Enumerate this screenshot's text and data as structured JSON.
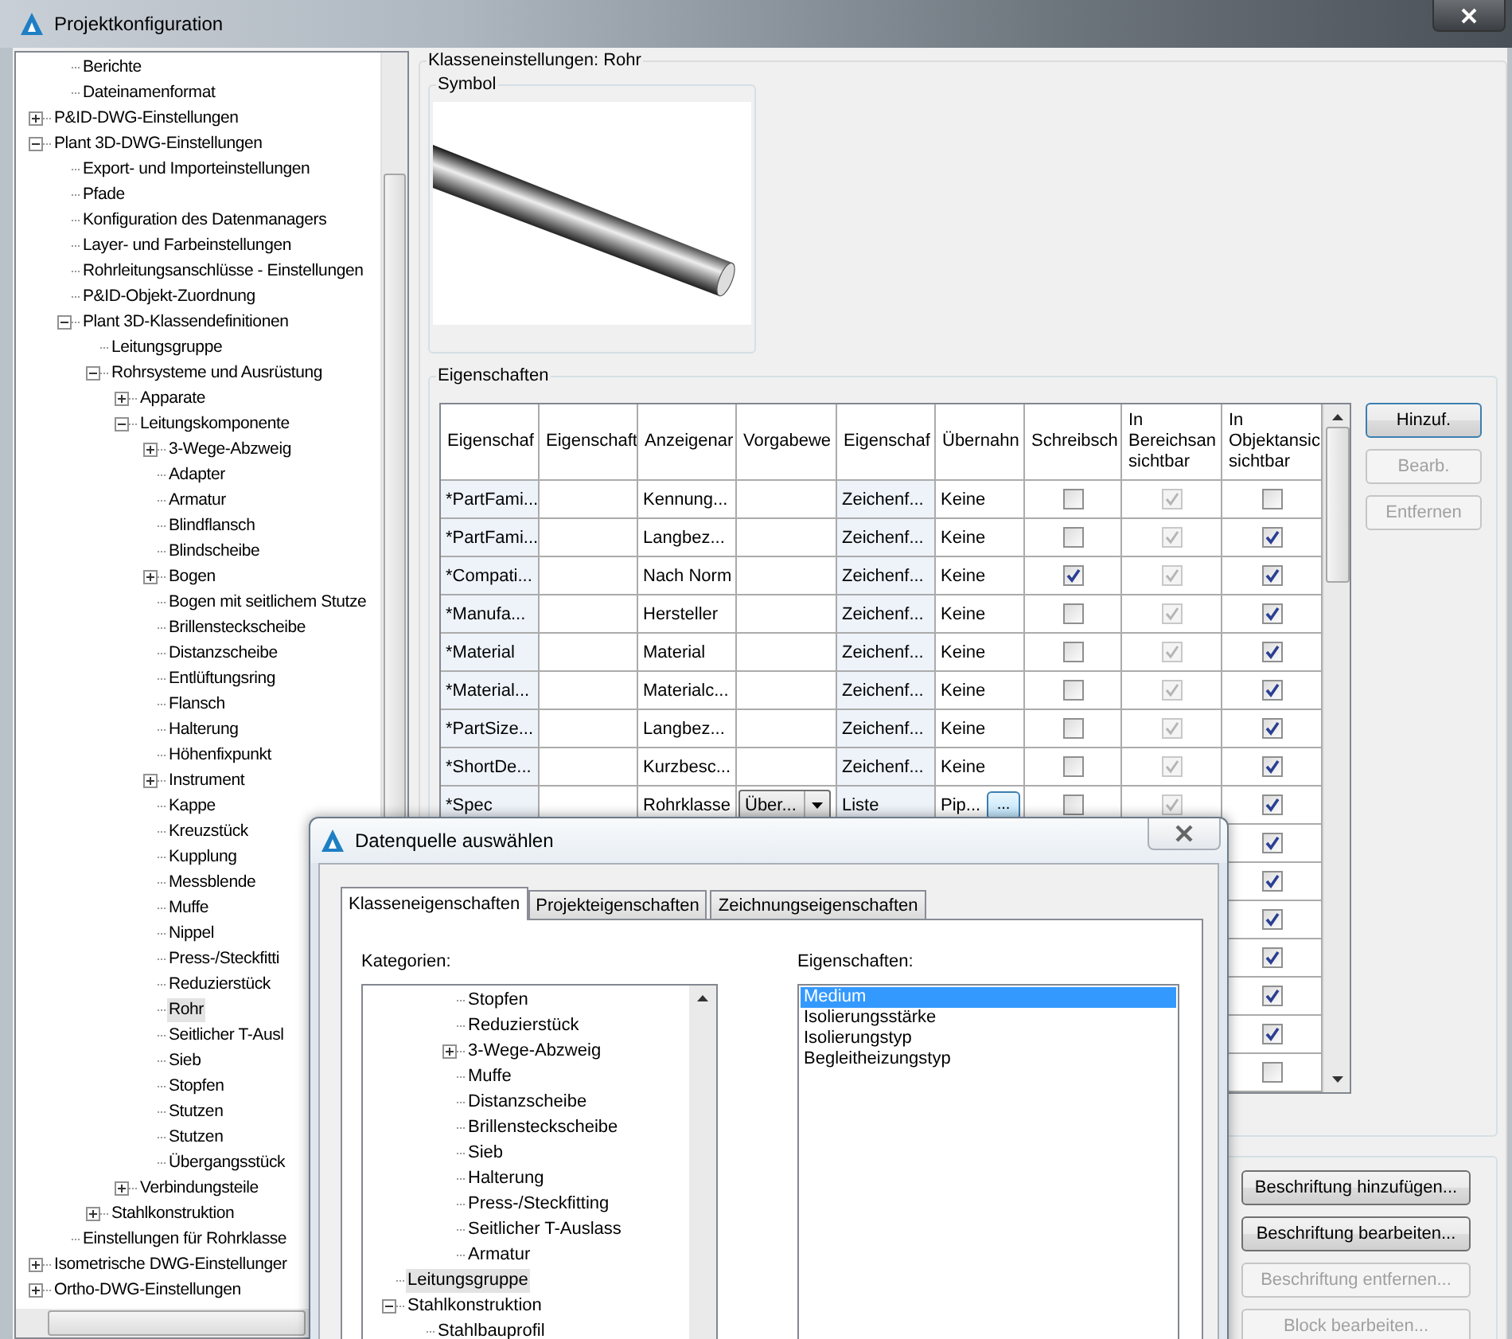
{
  "window": {
    "title": "Projektkonfiguration"
  },
  "tree": [
    {
      "children": [
        {
          "label": "Berichte",
          "selected": false
        },
        {
          "label": "Dateinamenformat",
          "selected": false
        }
      ]
    },
    {
      "label": "P&ID-DWG-Einstellungen",
      "selected": false,
      "expanded": false
    },
    {
      "label": "Plant 3D-DWG-Einstellungen",
      "selected": false,
      "expanded": true,
      "children": [
        {
          "label": "Export- und Importeinstellungen",
          "selected": false
        },
        {
          "label": "Pfade",
          "selected": false
        },
        {
          "label": "Konfiguration des Datenmanagers",
          "selected": false
        },
        {
          "label": "Layer- und Farbeinstellungen",
          "selected": false
        },
        {
          "label": "Rohrleitungsanschlüsse - Einstellungen",
          "selected": false
        },
        {
          "label": "P&ID-Objekt-Zuordnung",
          "selected": false
        },
        {
          "label": "Plant 3D-Klassendefinitionen",
          "selected": false,
          "expanded": true,
          "children": [
            {
              "label": "Leitungsgruppe",
              "selected": false
            },
            {
              "label": "Rohrsysteme und Ausrüstung",
              "selected": false,
              "expanded": true,
              "children": [
                {
                  "label": "Apparate",
                  "selected": false,
                  "expanded": false
                },
                {
                  "label": "Leitungskomponente",
                  "selected": false,
                  "expanded": true,
                  "children": [
                    {
                      "label": "3-Wege-Abzweig",
                      "selected": false,
                      "expanded": false
                    },
                    {
                      "label": "Adapter",
                      "selected": false
                    },
                    {
                      "label": "Armatur",
                      "selected": false
                    },
                    {
                      "label": "Blindflansch",
                      "selected": false
                    },
                    {
                      "label": "Blindscheibe",
                      "selected": false
                    },
                    {
                      "label": "Bogen",
                      "selected": false,
                      "expanded": false
                    },
                    {
                      "label": "Bogen mit seitlichem Stutze",
                      "selected": false
                    },
                    {
                      "label": "Brillensteckscheibe",
                      "selected": false
                    },
                    {
                      "label": "Distanzscheibe",
                      "selected": false
                    },
                    {
                      "label": "Entlüftungsring",
                      "selected": false
                    },
                    {
                      "label": "Flansch",
                      "selected": false
                    },
                    {
                      "label": "Halterung",
                      "selected": false
                    },
                    {
                      "label": "Höhenfixpunkt",
                      "selected": false
                    },
                    {
                      "label": "Instrument",
                      "selected": false,
                      "expanded": false
                    },
                    {
                      "label": "Kappe",
                      "selected": false
                    },
                    {
                      "label": "Kreuzstück",
                      "selected": false
                    },
                    {
                      "label": "Kupplung",
                      "selected": false
                    },
                    {
                      "label": "Messblende",
                      "selected": false
                    },
                    {
                      "label": "Muffe",
                      "selected": false
                    },
                    {
                      "label": "Nippel",
                      "selected": false
                    },
                    {
                      "label": "Press-/Steckfitti",
                      "selected": false
                    },
                    {
                      "label": "Reduzierstück",
                      "selected": false
                    },
                    {
                      "label": "Rohr",
                      "selected": true
                    },
                    {
                      "label": "Seitlicher T-Ausl",
                      "selected": false
                    },
                    {
                      "label": "Sieb",
                      "selected": false
                    },
                    {
                      "label": "Stopfen",
                      "selected": false
                    },
                    {
                      "label": "Stutzen",
                      "selected": false
                    },
                    {
                      "label": "Stutzen",
                      "selected": false
                    },
                    {
                      "label": "Übergangsstück",
                      "selected": false
                    }
                  ]
                },
                {
                  "label": "Verbindungsteile",
                  "selected": false,
                  "expanded": false
                }
              ]
            },
            {
              "label": "Stahlkonstruktion",
              "selected": false,
              "expanded": false
            }
          ]
        },
        {
          "label": "Einstellungen für Rohrklasse",
          "selected": false
        }
      ]
    },
    {
      "label": "Isometrische DWG-Einstellunger",
      "selected": false,
      "expanded": false
    },
    {
      "label": "Ortho-DWG-Einstellungen",
      "selected": false,
      "expanded": false
    }
  ],
  "class_settings": {
    "title": "Klasseneinstellungen: Rohr",
    "symbol_label": "Symbol"
  },
  "properties": {
    "title": "Eigenschaften",
    "columns": [
      "Eigenschaf",
      "Eigenschaft",
      "Anzeigenar",
      "Vorgabewe",
      "Eigenschaf",
      "Übernahn",
      "Schreibsch",
      "In\nBereichsan\nsichtbar",
      "In\nObjektansic\nsichtbar"
    ],
    "rows": [
      {
        "property": "*PartFami...",
        "display_name": "Kennung...",
        "type": "Zeichenf...",
        "transfer": "Keine",
        "write_protected": false,
        "area_visible": true,
        "object_visible": false
      },
      {
        "property": "*PartFami...",
        "display_name": "Langbez...",
        "type": "Zeichenf...",
        "transfer": "Keine",
        "write_protected": false,
        "area_visible": true,
        "object_visible": true
      },
      {
        "property": "*Compati...",
        "display_name": "Nach Norm",
        "type": "Zeichenf...",
        "transfer": "Keine",
        "write_protected": true,
        "area_visible": true,
        "object_visible": true
      },
      {
        "property": "*Manufa...",
        "display_name": "Hersteller",
        "type": "Zeichenf...",
        "transfer": "Keine",
        "write_protected": false,
        "area_visible": true,
        "object_visible": true
      },
      {
        "property": "*Material",
        "display_name": "Material",
        "type": "Zeichenf...",
        "transfer": "Keine",
        "write_protected": false,
        "area_visible": true,
        "object_visible": true
      },
      {
        "property": "*Material...",
        "display_name": "Materialc...",
        "type": "Zeichenf...",
        "transfer": "Keine",
        "write_protected": false,
        "area_visible": true,
        "object_visible": true
      },
      {
        "property": "*PartSize...",
        "display_name": "Langbez...",
        "type": "Zeichenf...",
        "transfer": "Keine",
        "write_protected": false,
        "area_visible": true,
        "object_visible": true
      },
      {
        "property": "*ShortDe...",
        "display_name": "Kurzbesc...",
        "type": "Zeichenf...",
        "transfer": "Keine",
        "write_protected": false,
        "area_visible": true,
        "object_visible": true
      },
      {
        "property": "*Spec",
        "display_name": "Rohrklasse",
        "default_dropdown": "Über...",
        "type": "Liste",
        "transfer": "Pip...",
        "transfer_button": "...",
        "write_protected": false,
        "area_visible": true,
        "object_visible": true
      }
    ],
    "covered_rows": [
      {
        "object_visible": true
      },
      {
        "object_visible": true
      },
      {
        "object_visible": true
      },
      {
        "object_visible": true
      },
      {
        "object_visible": true
      },
      {
        "object_visible": true
      },
      {
        "object_visible": false
      }
    ],
    "buttons": [
      {
        "label": "Hinzuf.",
        "disabled": false
      },
      {
        "label": "Bearb.",
        "disabled": true
      },
      {
        "label": "Entfernen",
        "disabled": true
      }
    ]
  },
  "label_buttons": [
    {
      "label": "Beschriftung hinzufügen...",
      "disabled": false
    },
    {
      "label": "Beschriftung bearbeiten...",
      "disabled": false
    },
    {
      "label": "Beschriftung entfernen...",
      "disabled": true
    },
    {
      "label": "Block bearbeiten...",
      "disabled": true
    }
  ],
  "dialog": {
    "title": "Datenquelle auswählen",
    "tabs": [
      {
        "label": "Klasseneigenschaften",
        "selected": true
      },
      {
        "label": "Projekteigenschaften",
        "selected": false
      },
      {
        "label": "Zeichnungseigenschaften",
        "selected": false
      }
    ],
    "categories_label": "Kategorien:",
    "tree": [
      {
        "children": [
          {
            "children": [
              {
                "label": "Stopfen",
                "selected": false
              },
              {
                "label": "Reduzierstück",
                "selected": false
              },
              {
                "label": "3-Wege-Abzweig",
                "selected": false,
                "expanded": false
              },
              {
                "label": "Muffe",
                "selected": false
              },
              {
                "label": "Distanzscheibe",
                "selected": false
              },
              {
                "label": "Brillensteckscheibe",
                "selected": false
              },
              {
                "label": "Sieb",
                "selected": false
              },
              {
                "label": "Halterung",
                "selected": false
              },
              {
                "label": "Press-/Steckfitting",
                "selected": false
              },
              {
                "label": "Seitlicher T-Auslass",
                "selected": false
              },
              {
                "label": "Armatur",
                "selected": false
              }
            ]
          }
        ]
      },
      {
        "label": "Leitungsgruppe",
        "selected": true
      },
      {
        "label": "Stahlkonstruktion",
        "selected": false,
        "expanded": true,
        "children": [
          {
            "label": "Stahlbauprofil",
            "selected": false
          }
        ]
      }
    ],
    "properties_label": "Eigenschaften:",
    "properties": [
      {
        "label": "Medium",
        "selected": true
      },
      {
        "label": "Isolierungsstärke",
        "selected": false
      },
      {
        "label": "Isolierungstyp",
        "selected": false
      },
      {
        "label": "Begleitheizungstyp",
        "selected": false
      }
    ]
  }
}
